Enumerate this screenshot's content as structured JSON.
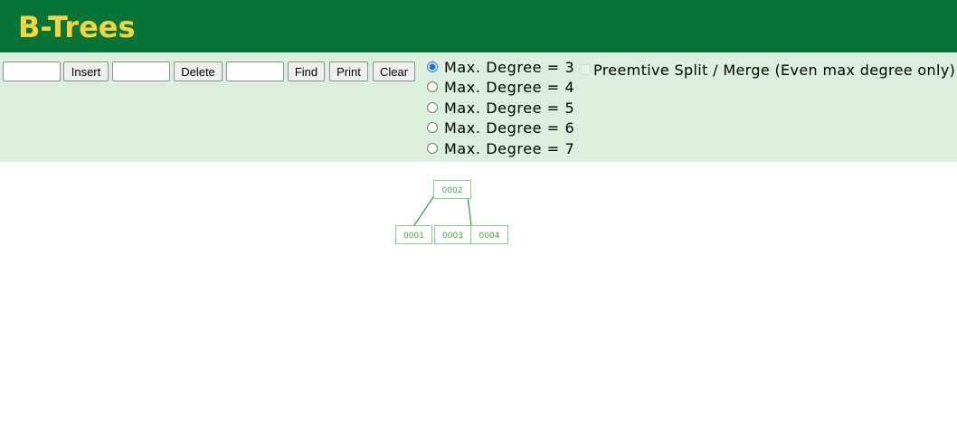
{
  "header": {
    "title": "B-Trees"
  },
  "controls": {
    "insert_value": "",
    "insert_label": "Insert",
    "delete_value": "",
    "delete_label": "Delete",
    "find_value": "",
    "find_label": "Find",
    "print_label": "Print",
    "clear_label": "Clear",
    "degree_options": [
      {
        "label": "Max. Degree = 3",
        "checked": true
      },
      {
        "label": "Max. Degree = 4",
        "checked": false
      },
      {
        "label": "Max. Degree = 5",
        "checked": false
      },
      {
        "label": "Max. Degree = 6",
        "checked": false
      },
      {
        "label": "Max. Degree = 7",
        "checked": false
      }
    ],
    "preemptive_label": "Preemtive Split / Merge (Even max degree only)",
    "preemptive_checked": false,
    "preemptive_enabled": false
  },
  "tree": {
    "root": {
      "keys": [
        "0002"
      ]
    },
    "children": [
      {
        "keys": [
          "0001"
        ]
      },
      {
        "keys": [
          "0003",
          "0004"
        ]
      }
    ]
  },
  "colors": {
    "header_bg": "#087438",
    "title": "#f5d53f",
    "controls_bg": "#dcefdc",
    "node_border": "#7fd37f",
    "node_text": "#3ea83e",
    "edge": "#4caf50"
  }
}
